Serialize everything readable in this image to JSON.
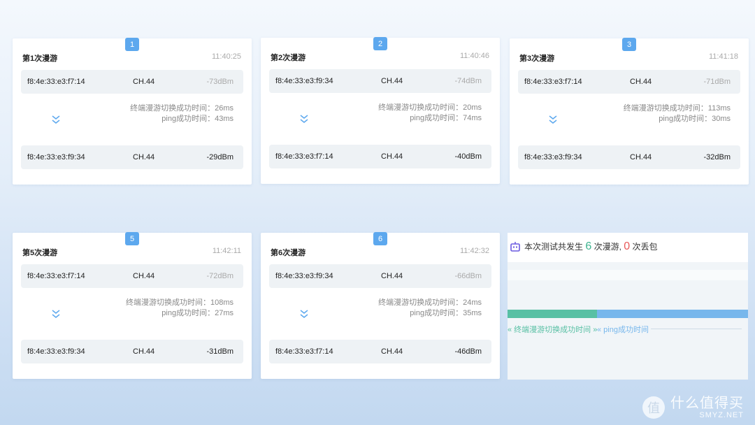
{
  "cards": [
    {
      "badge": "1",
      "title": "第1次漫游",
      "time": "11:40:25",
      "top": {
        "mac": "f8:4e:33:e3:f7:14",
        "ch": "CH.44",
        "dbm": "-73dBm"
      },
      "bottom": {
        "mac": "f8:4e:33:e3:f9:34",
        "ch": "CH.44",
        "dbm": "-29dBm"
      },
      "switch_label": "终端漫游切换成功时间：26ms",
      "ping_label": "ping成功时间：43ms"
    },
    {
      "badge": "2",
      "title": "第2次漫游",
      "time": "11:40:46",
      "top": {
        "mac": "f8:4e:33:e3:f9:34",
        "ch": "CH.44",
        "dbm": "-74dBm"
      },
      "bottom": {
        "mac": "f8:4e:33:e3:f7:14",
        "ch": "CH.44",
        "dbm": "-40dBm"
      },
      "switch_label": "终端漫游切换成功时间：20ms",
      "ping_label": "ping成功时间：74ms"
    },
    {
      "badge": "3",
      "title": "第3次漫游",
      "time": "11:41:18",
      "top": {
        "mac": "f8:4e:33:e3:f7:14",
        "ch": "CH.44",
        "dbm": "-71dBm"
      },
      "bottom": {
        "mac": "f8:4e:33:e3:f9:34",
        "ch": "CH.44",
        "dbm": "-32dBm"
      },
      "switch_label": "终端漫游切换成功时间：113ms",
      "ping_label": "ping成功时间：30ms"
    },
    {
      "badge": "5",
      "title": "第5次漫游",
      "time": "11:42:11",
      "top": {
        "mac": "f8:4e:33:e3:f7:14",
        "ch": "CH.44",
        "dbm": "-72dBm"
      },
      "bottom": {
        "mac": "f8:4e:33:e3:f9:34",
        "ch": "CH.44",
        "dbm": "-31dBm"
      },
      "switch_label": "终端漫游切换成功时间：108ms",
      "ping_label": "ping成功时间：27ms"
    },
    {
      "badge": "6",
      "title": "第6次漫游",
      "time": "11:42:32",
      "top": {
        "mac": "f8:4e:33:e3:f9:34",
        "ch": "CH.44",
        "dbm": "-66dBm"
      },
      "bottom": {
        "mac": "f8:4e:33:e3:f7:14",
        "ch": "CH.44",
        "dbm": "-46dBm"
      },
      "switch_label": "终端漫游切换成功时间：24ms",
      "ping_label": "ping成功时间：35ms"
    }
  ],
  "summary": {
    "prefix": "本次测试共发生",
    "roam_count": "6",
    "roam_suffix": "次漫游,",
    "loss_count": "0",
    "loss_suffix": "次丢包",
    "legend_switch": "«  终端漫游切换成功时间 »",
    "legend_ping": "«          ping成功时间",
    "green": "#58c0a4",
    "blue": "#77b7ec",
    "red": "#e85a5a"
  },
  "watermark": {
    "cn": "什么值得买",
    "en": "SMYZ.NET",
    "icon": "值"
  }
}
